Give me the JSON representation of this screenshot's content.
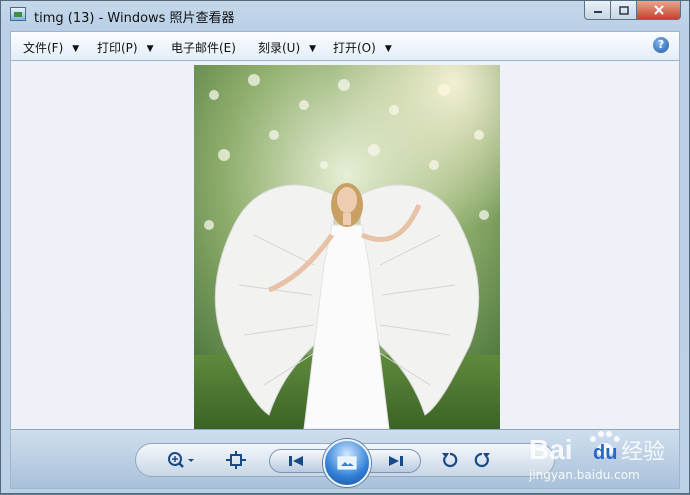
{
  "window": {
    "title": "timg (13) - Windows 照片查看器",
    "minimize_icon": "minimize-icon",
    "maximize_icon": "maximize-icon",
    "close_icon": "close-icon"
  },
  "menu": {
    "items": [
      {
        "label": "文件(F)",
        "has_dropdown": true
      },
      {
        "label": "打印(P)",
        "has_dropdown": true
      },
      {
        "label": "电子邮件(E)",
        "has_dropdown": false
      },
      {
        "label": "刻录(U)",
        "has_dropdown": true
      },
      {
        "label": "打开(O)",
        "has_dropdown": true
      }
    ],
    "help_icon": "help-icon",
    "help_symbol": "?"
  },
  "viewer": {
    "image_icon": "photo-angel-wings"
  },
  "toolbar": {
    "zoom_icon": "zoom-icon",
    "actual_size_icon": "fit-window-icon",
    "previous_icon": "previous-icon",
    "slideshow_icon": "slideshow-icon",
    "next_icon": "next-icon",
    "rotate_ccw_icon": "rotate-counterclockwise-icon",
    "rotate_cw_icon": "rotate-clockwise-icon",
    "delete_icon": "delete-icon"
  },
  "watermark": {
    "brand": "Bai",
    "brand2": "du",
    "suffix": "经验",
    "url": "jingyan.baidu.com"
  },
  "colors": {
    "accent": "#1c59a8",
    "close": "#c7432a"
  }
}
